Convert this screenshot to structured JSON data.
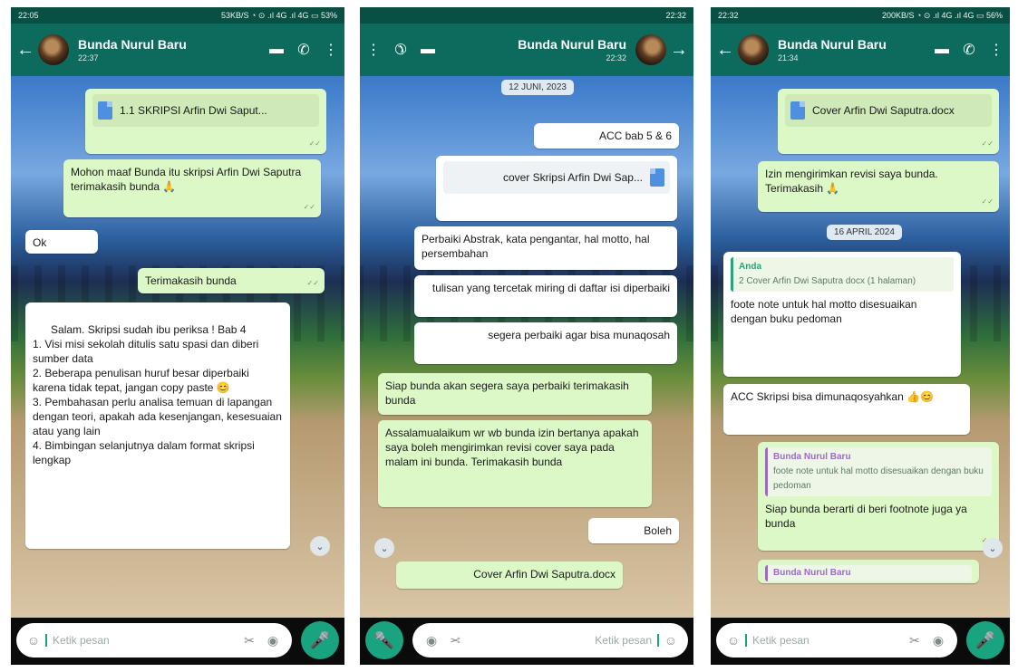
{
  "screens": [
    {
      "status_time": "22:05",
      "status_right": "53KB/S ◔ ⊙ .ıl 4G .ıl 4G ▭ 53%",
      "contact_name": "Bunda Nurul Baru",
      "last_seen": "22:37",
      "file_name": "1.1 SKRIPSI Arfin Dwi Saput...",
      "messages": [
        {
          "text": "Mohon maaf Bunda itu skripsi Arfin Dwi Saputra terimakasih bunda 🙏"
        },
        {
          "text": "Ok"
        },
        {
          "text": "Terimakasih bunda"
        },
        {
          "text": "Salam. Skripsi sudah ibu periksa ! Bab 4\n1. Visi misi sekolah ditulis satu spasi dan diberi sumber data\n2. Beberapa penulisan huruf besar diperbaiki karena tidak tepat, jangan copy paste 😊\n3. Pembahasan perlu analisa temuan di lapangan dengan teori, apakah ada kesenjangan, kesesuaian atau yang lain\n4. Bimbingan selanjutnya dalam format skripsi lengkap"
        }
      ],
      "input_placeholder": "Ketik pesan"
    },
    {
      "status_time": "22:32",
      "contact_name": "Bunda Nurul Baru",
      "last_seen": "22:32",
      "date_chip": "12 JUNI, 2023",
      "file_name": "cover Skripsi Arfin Dwi Sap...",
      "messages": [
        {
          "text": "ACC bab 5 & 6"
        },
        {
          "text": "Perbaiki Abstrak, kata pengantar, hal motto, hal persembahan"
        },
        {
          "text": "tulisan yang tercetak miring di daftar isi diperbaiki"
        },
        {
          "text": "segera perbaiki agar bisa munaqosah"
        },
        {
          "text": "Siap bunda akan segera saya perbaiki terimakasih bunda"
        },
        {
          "text": "Assalamualaikum wr wb bunda izin bertanya apakah saya boleh mengirimkan revisi cover saya pada malam ini bunda. Terimakasih bunda"
        },
        {
          "text": "Boleh"
        },
        {
          "text": "Cover Arfin Dwi Saputra.docx"
        }
      ],
      "input_placeholder": "Ketik pesan"
    },
    {
      "status_time": "22:32",
      "status_right": "200KB/S ◔ ⊙ .ıl 4G .ıl 4G ▭ 56%",
      "contact_name": "Bunda Nurul Baru",
      "last_seen": "21:34",
      "file_name": "Cover Arfin Dwi Saputra.docx",
      "date_chip": "16 APRIL 2024",
      "messages": [
        {
          "text": "Izin mengirimkan revisi saya bunda. Terimakasih 🙏"
        },
        {
          "quote_name": "Anda",
          "quote_text": "2 Cover Arfin Dwi Saputra docx (1 halaman)",
          "text": "foote note untuk hal motto disesuaikan dengan buku pedoman"
        },
        {
          "text": "ACC Skripsi bisa dimunaqosyahkan 👍😊"
        },
        {
          "quote_name": "Bunda Nurul Baru",
          "quote_text": "foote note untuk hal motto disesuaikan dengan buku pedoman",
          "text": "Siap bunda berarti di beri footnote juga ya bunda"
        },
        {
          "text": "Bunda Nurul Baru"
        }
      ],
      "input_placeholder": "Ketik pesan"
    }
  ]
}
